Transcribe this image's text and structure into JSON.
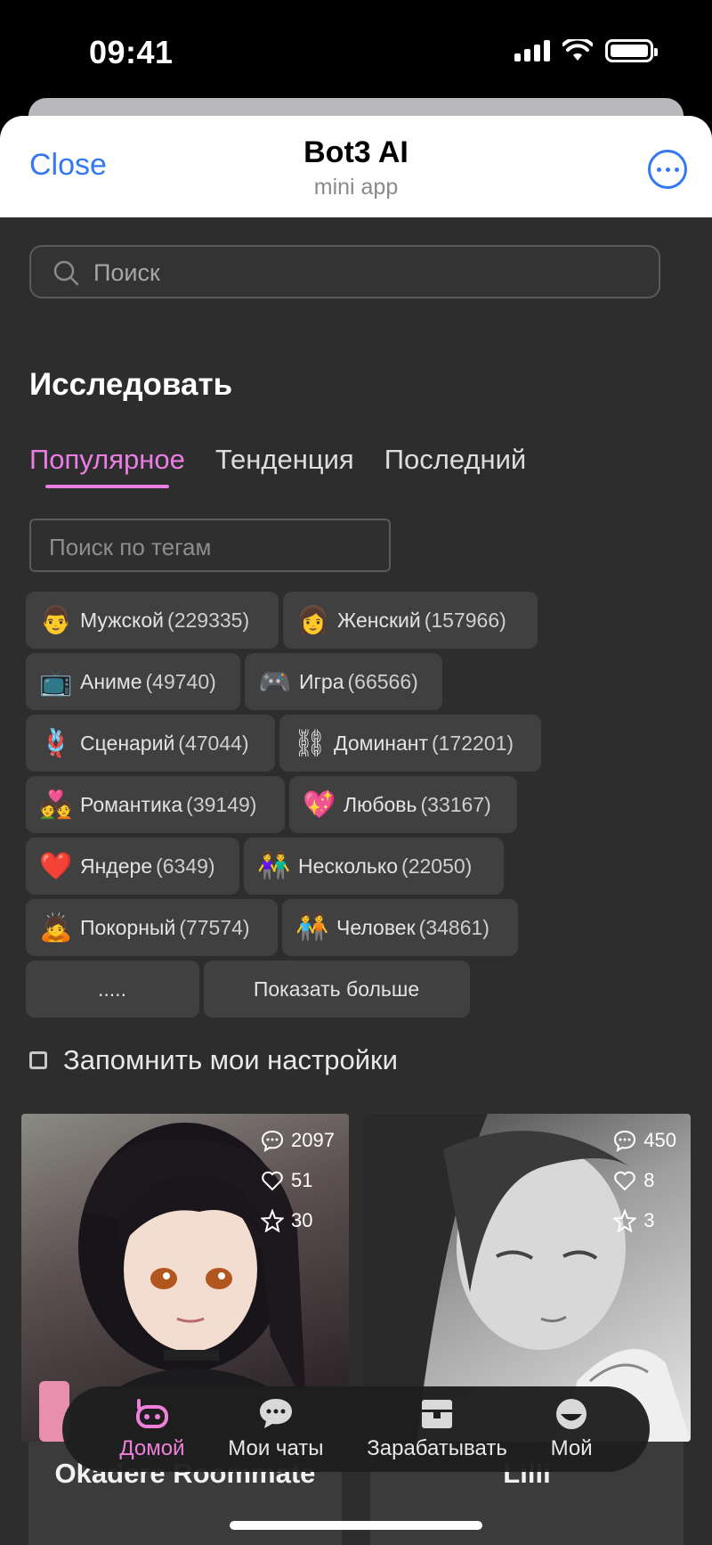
{
  "status_bar": {
    "time": "09:41"
  },
  "header": {
    "close_label": "Close",
    "title": "Bot3 AI",
    "subtitle": "mini app"
  },
  "search": {
    "placeholder": "Поиск"
  },
  "explore": {
    "title": "Исследовать"
  },
  "tabs": [
    {
      "label": "Популярное",
      "active": true
    },
    {
      "label": "Тенденция",
      "active": false
    },
    {
      "label": "Последний",
      "active": false
    }
  ],
  "tag_search": {
    "placeholder": "Поиск по тегам"
  },
  "tags": [
    {
      "emoji": "👨",
      "label": "Мужской",
      "count": "(229335)"
    },
    {
      "emoji": "👩",
      "label": "Женский",
      "count": "(157966)"
    },
    {
      "emoji": "📺",
      "label": "Аниме",
      "count": "(49740)"
    },
    {
      "emoji": "🎮",
      "label": "Игра",
      "count": "(66566)"
    },
    {
      "emoji": "🪢",
      "label": "Сценарий",
      "count": "(47044)"
    },
    {
      "emoji": "⛓",
      "label": "Доминант",
      "count": "(172201)"
    },
    {
      "emoji": "💑",
      "label": "Романтика",
      "count": "(39149)"
    },
    {
      "emoji": "💖",
      "label": "Любовь",
      "count": "(33167)"
    },
    {
      "emoji": "❤️",
      "label": "Яндере",
      "count": "(6349)"
    },
    {
      "emoji": "👫",
      "label": "Несколько",
      "count": "(22050)"
    },
    {
      "emoji": "🙇",
      "label": "Покорный",
      "count": "(77574)"
    },
    {
      "emoji": "🧑‍🤝‍🧑",
      "label": "Человек",
      "count": "(34861)"
    }
  ],
  "more_dots": ".....",
  "show_more": "Показать больше",
  "remember": {
    "label": "Запомнить мои настройки"
  },
  "cards": [
    {
      "name": "Okadere Roommate",
      "chats": "2097",
      "likes": "51",
      "stars": "30"
    },
    {
      "name": "Lilli",
      "chats": "450",
      "likes": "8",
      "stars": "3"
    }
  ],
  "nav": [
    {
      "label": "Домой",
      "icon": "home-bot-icon",
      "active": true
    },
    {
      "label": "Мои чаты",
      "icon": "chat-bubble-icon",
      "active": false
    },
    {
      "label": "Зарабатывать",
      "icon": "wallet-icon",
      "active": false
    },
    {
      "label": "Мой",
      "icon": "profile-icon",
      "active": false
    }
  ],
  "colors": {
    "accent": "#ea7ee5",
    "link": "#3478f6",
    "background": "#2d2d2d"
  }
}
